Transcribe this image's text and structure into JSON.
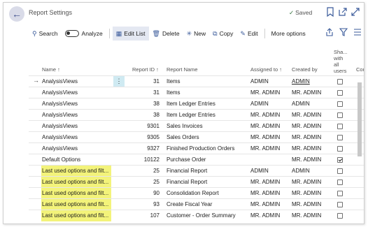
{
  "header": {
    "title": "Report Settings",
    "saved_label": "Saved",
    "icons": [
      "back-arrow-icon",
      "bookmark-icon",
      "open-new-window-icon",
      "expand-icon"
    ]
  },
  "actions": {
    "search": "Search",
    "analyze": "Analyze",
    "edit_list": "Edit List",
    "delete": "Delete",
    "new": "New",
    "copy": "Copy",
    "edit": "Edit",
    "more": "More options"
  },
  "table": {
    "columns": {
      "name": "Name ↑",
      "report_id": "Report ID ↑",
      "report_name": "Report Name",
      "assigned_to": "Assigned to ↑",
      "created_by": "Created by",
      "shared": [
        "Sha...",
        "with",
        "all",
        "users"
      ],
      "extra": "Cor"
    },
    "rows": [
      {
        "name": "AnalysisViews",
        "report_id": "31",
        "report_name": "Items",
        "assigned_to": "ADMIN",
        "created_by": "ADMIN",
        "shared": false,
        "highlight": false,
        "selected": true
      },
      {
        "name": "AnalysisViews",
        "report_id": "31",
        "report_name": "Items",
        "assigned_to": "MR. ADMIN",
        "created_by": "MR. ADMIN",
        "shared": false,
        "highlight": false,
        "selected": false
      },
      {
        "name": "AnalysisViews",
        "report_id": "38",
        "report_name": "Item Ledger Entries",
        "assigned_to": "ADMIN",
        "created_by": "ADMIN",
        "shared": false,
        "highlight": false,
        "selected": false
      },
      {
        "name": "AnalysisViews",
        "report_id": "38",
        "report_name": "Item Ledger Entries",
        "assigned_to": "MR. ADMIN",
        "created_by": "MR. ADMIN",
        "shared": false,
        "highlight": false,
        "selected": false
      },
      {
        "name": "AnalysisViews",
        "report_id": "9301",
        "report_name": "Sales Invoices",
        "assigned_to": "MR. ADMIN",
        "created_by": "MR. ADMIN",
        "shared": false,
        "highlight": false,
        "selected": false
      },
      {
        "name": "AnalysisViews",
        "report_id": "9305",
        "report_name": "Sales Orders",
        "assigned_to": "MR. ADMIN",
        "created_by": "MR. ADMIN",
        "shared": false,
        "highlight": false,
        "selected": false
      },
      {
        "name": "AnalysisViews",
        "report_id": "9327",
        "report_name": "Finished Production Orders",
        "assigned_to": "MR. ADMIN",
        "created_by": "MR. ADMIN",
        "shared": false,
        "highlight": false,
        "selected": false
      },
      {
        "name": "Default Options",
        "report_id": "10122",
        "report_name": "Purchase Order",
        "assigned_to": "",
        "created_by": "MR. ADMIN",
        "shared": true,
        "highlight": false,
        "selected": false
      },
      {
        "name": "Last used options and filt...",
        "report_id": "25",
        "report_name": "Financial Report",
        "assigned_to": "ADMIN",
        "created_by": "ADMIN",
        "shared": false,
        "highlight": true,
        "selected": false
      },
      {
        "name": "Last used options and filt...",
        "report_id": "25",
        "report_name": "Financial Report",
        "assigned_to": "MR. ADMIN",
        "created_by": "MR. ADMIN",
        "shared": false,
        "highlight": true,
        "selected": false
      },
      {
        "name": "Last used options and filt...",
        "report_id": "90",
        "report_name": "Consolidation Report",
        "assigned_to": "MR. ADMIN",
        "created_by": "MR. ADMIN",
        "shared": false,
        "highlight": true,
        "selected": false
      },
      {
        "name": "Last used options and filt...",
        "report_id": "93",
        "report_name": "Create Fiscal Year",
        "assigned_to": "MR. ADMIN",
        "created_by": "MR. ADMIN",
        "shared": false,
        "highlight": true,
        "selected": false
      },
      {
        "name": "Last used options and filt...",
        "report_id": "107",
        "report_name": "Customer - Order Summary",
        "assigned_to": "MR. ADMIN",
        "created_by": "MR. ADMIN",
        "shared": false,
        "highlight": true,
        "selected": false
      }
    ]
  },
  "colors": {
    "highlight": "#f3f37a",
    "selected_menu": "#cfeaf2",
    "accent": "#3a5a9a"
  }
}
